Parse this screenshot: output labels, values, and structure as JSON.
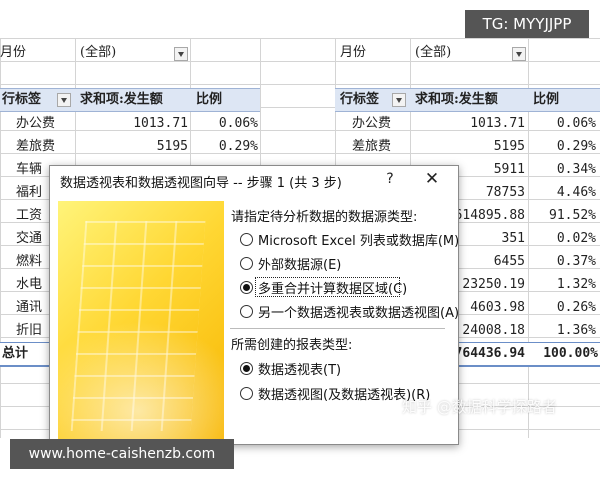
{
  "watermarks": {
    "tg": "TG: MYYJJPP",
    "url": "www.home-caishenzb.com",
    "zhihu": "知乎 @数据科学探路者"
  },
  "left_table": {
    "filter_label": "月份",
    "filter_value": "(全部)",
    "headers": [
      "行标签",
      "求和项:发生额",
      "比例"
    ],
    "rows": [
      {
        "label": "办公费",
        "amount": "1013.71",
        "ratio": "0.06%"
      },
      {
        "label": "差旅费",
        "amount": "5195",
        "ratio": "0.29%"
      },
      {
        "label": "车辆"
      },
      {
        "label": "福利"
      },
      {
        "label": "工资"
      },
      {
        "label": "交通"
      },
      {
        "label": "燃料"
      },
      {
        "label": "水电"
      },
      {
        "label": "通讯"
      },
      {
        "label": "折旧"
      }
    ],
    "total_label": "总计"
  },
  "right_table": {
    "filter_label": "月份",
    "filter_value": "(全部)",
    "headers": [
      "行标签",
      "求和项:发生额",
      "比例"
    ],
    "rows": [
      {
        "label": "办公费",
        "amount": "1013.71",
        "ratio": "0.06%"
      },
      {
        "label": "差旅费",
        "amount": "5195",
        "ratio": "0.29%"
      },
      {
        "amount": "5911",
        "ratio": "0.34%"
      },
      {
        "amount": "78753",
        "ratio": "4.46%"
      },
      {
        "amount": "614895.88",
        "ratio": "91.52%"
      },
      {
        "amount": "351",
        "ratio": "0.02%"
      },
      {
        "amount": "6455",
        "ratio": "0.37%"
      },
      {
        "amount": "23250.19",
        "ratio": "1.32%"
      },
      {
        "amount": "4603.98",
        "ratio": "0.26%"
      },
      {
        "amount": "24008.18",
        "ratio": "1.36%"
      }
    ],
    "total_amount": "764436.94",
    "total_ratio": "100.00%"
  },
  "dialog": {
    "title": "数据透视表和数据透视图向导 -- 步骤 1 (共 3 步)",
    "help_label": "?",
    "close_label": "✕",
    "source_prompt": "请指定待分析数据的数据源类型:",
    "source_options": [
      {
        "label": "Microsoft Excel 列表或数据库(M)",
        "selected": false
      },
      {
        "label": "外部数据源(E)",
        "selected": false
      },
      {
        "label": "多重合并计算数据区域(C)",
        "selected": true
      },
      {
        "label": "另一个数据透视表或数据透视图(A)",
        "selected": false
      }
    ],
    "report_prompt": "所需创建的报表类型:",
    "report_options": [
      {
        "label": "数据透视表(T)",
        "selected": true
      },
      {
        "label": "数据透视图(及数据透视表)(R)",
        "selected": false
      }
    ]
  }
}
